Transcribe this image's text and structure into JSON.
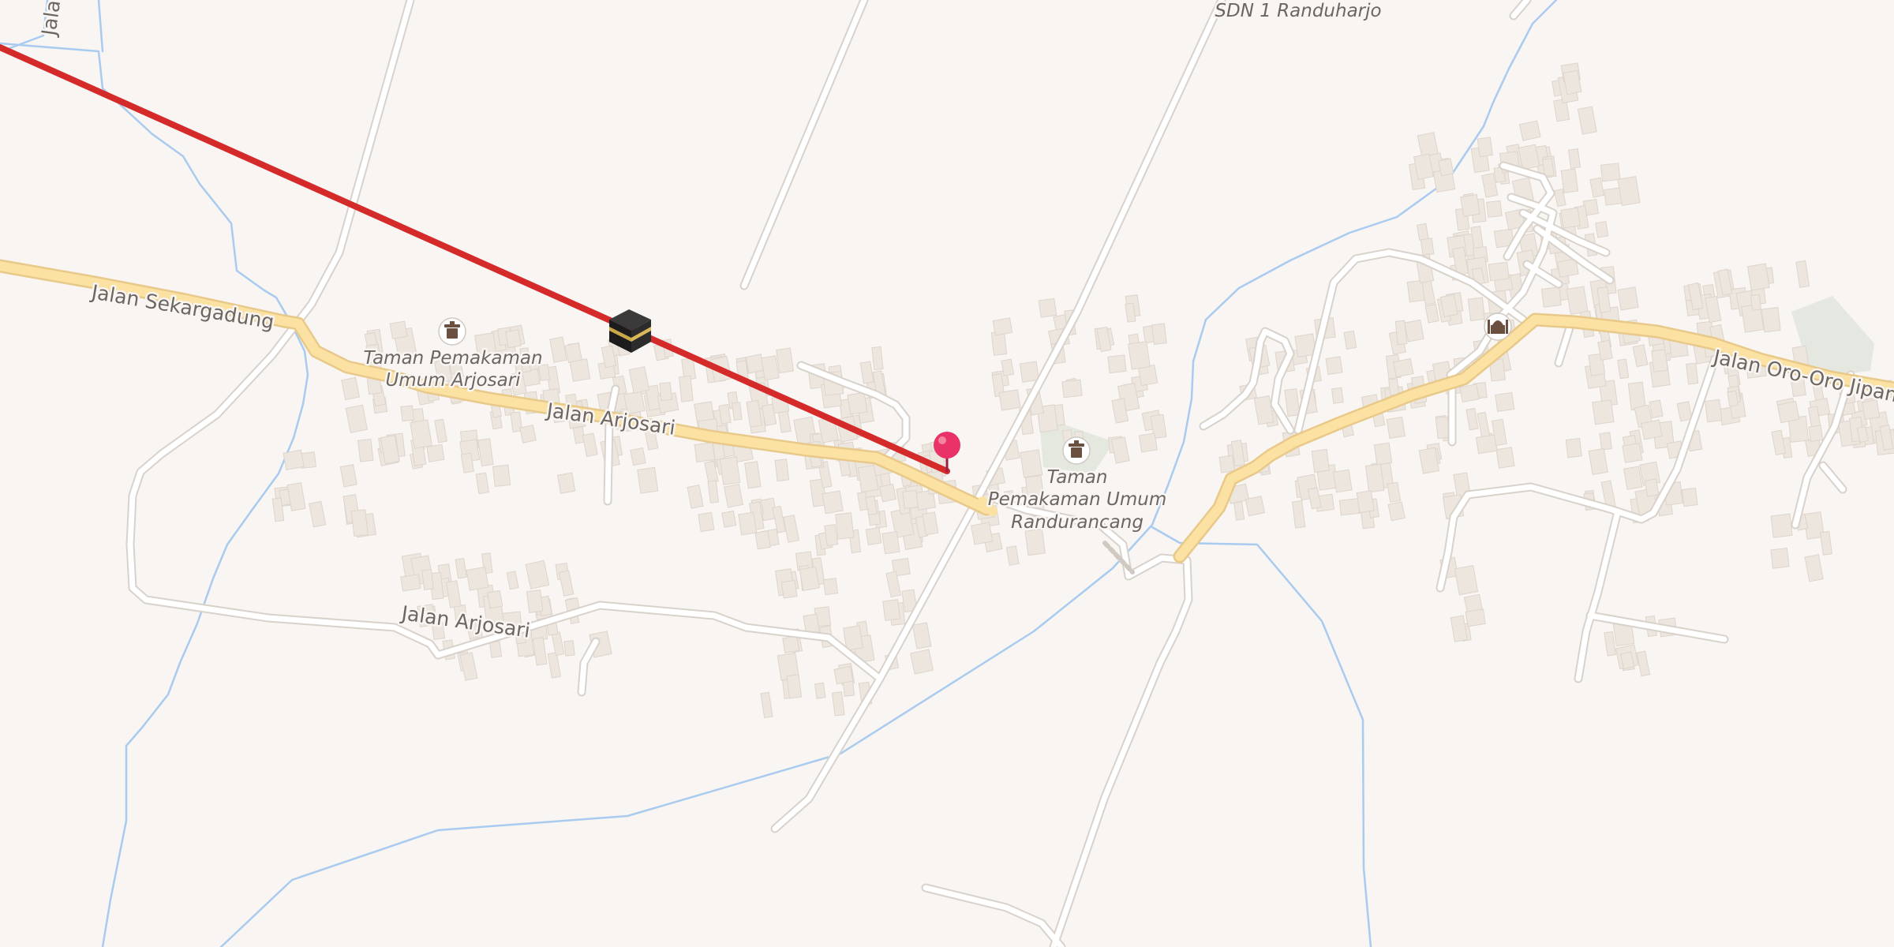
{
  "map": {
    "colors": {
      "background": "#f8f5f2",
      "water": "#a9cbef",
      "primary_road": "#fbe2a3",
      "minor_road": "#ffffff",
      "building": "#ece6df",
      "route": "#d42a2a",
      "pin": "#e83268",
      "park": "#e5e8e0"
    },
    "road_labels": {
      "sekargadung": "Jalan Sekargadung",
      "arjosari_main": "Jalan Arjosari",
      "arjosari_south": "Jalan Arjosari",
      "oro_oro": "Jalan Oro-Oro Jipang",
      "jalan_top": "Jalan"
    },
    "poi": {
      "arjosari_cemetery": {
        "name_line1": "Taman Pemakaman",
        "name_line2": "Umum Arjosari",
        "icon": "cemetery-icon"
      },
      "randurancang_cemetery": {
        "name_line1": "Taman",
        "name_line2": "Pemakaman Umum",
        "name_line3": "Randurancang",
        "icon": "cemetery-icon"
      },
      "school": {
        "name": "SDN 1 Randuharjo"
      },
      "mosque": {
        "icon": "mosque-icon"
      }
    },
    "markers": {
      "kaaba": {
        "icon": "kaaba-icon"
      },
      "pin": {
        "icon": "location-pin-icon"
      }
    }
  }
}
